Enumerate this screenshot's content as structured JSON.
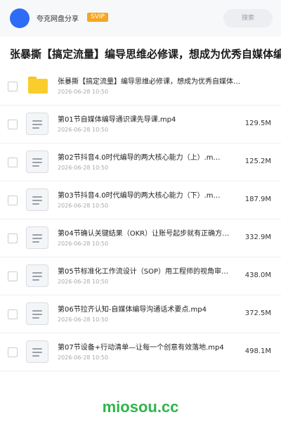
{
  "header": {
    "username": "夸克网盘分享",
    "badge": "SVIP",
    "search_label": "搜索"
  },
  "page_title": "张暴撕【搞定流量】编导思维必修课，想成为优秀自媒体编",
  "items": [
    {
      "type": "folder",
      "name": "张暴撕【搞定流量】编导思维必修课，想成为优秀自媒体…",
      "date": "2026-06-28 10:50",
      "size": ""
    },
    {
      "type": "file",
      "name": "第01节自媒体编导通识课先导课.mp4",
      "date": "2026-06-28 10:50",
      "size": "129.5M"
    },
    {
      "type": "file",
      "name": "第02节抖音4.0时代编导的两大核心能力（上）.m…",
      "date": "2026-06-28 10:50",
      "size": "125.2M"
    },
    {
      "type": "file",
      "name": "第03节抖音4.0时代编导的两大核心能力（下）.m…",
      "date": "2026-06-28 10:50",
      "size": "187.9M"
    },
    {
      "type": "file",
      "name": "第04节确认关键结果（OKR）让账号起步就有正确方…",
      "date": "2026-06-28 10:50",
      "size": "332.9M"
    },
    {
      "type": "file",
      "name": "第05节标准化工作流设计（SOP）用工程师的视角审…",
      "date": "2026-06-28 10:50",
      "size": "438.0M"
    },
    {
      "type": "file",
      "name": "第06节拉齐认知-自媒体编导沟通话术要点.mp4",
      "date": "2026-06-28 10:50",
      "size": "372.5M"
    },
    {
      "type": "file",
      "name": "第07节设备+行动清单—让每一个创意有效落地.mp4",
      "date": "2026-06-28 10:50",
      "size": "498.1M"
    }
  ],
  "watermark": "miosou.cc"
}
